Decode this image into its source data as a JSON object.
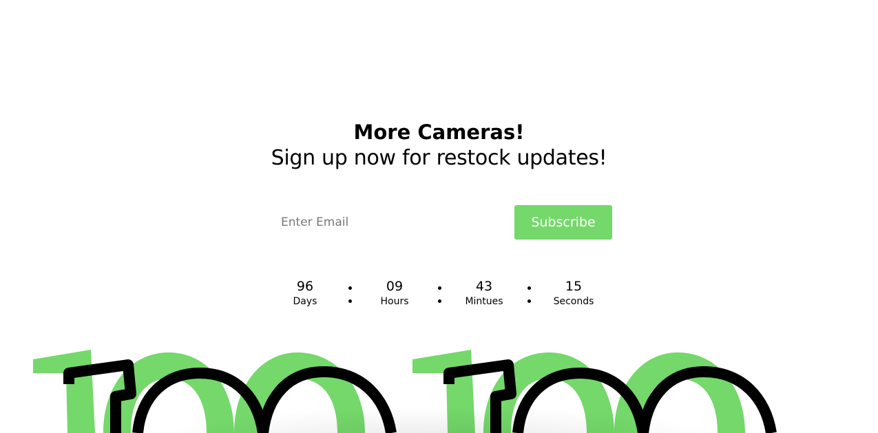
{
  "hero": {
    "title": "More Cameras!",
    "subtitle": "Sign up now for restock updates!"
  },
  "signup": {
    "email_placeholder": "Enter Email",
    "email_value": "",
    "subscribe_label": "Subscribe"
  },
  "countdown": {
    "days": {
      "value": "96",
      "label": "Days"
    },
    "hours": {
      "value": "09",
      "label": "Hours"
    },
    "minutes": {
      "value": "43",
      "label": "Mintues"
    },
    "seconds": {
      "value": "15",
      "label": "Seconds"
    }
  },
  "colors": {
    "accent": "#74d86a",
    "outline": "#000000",
    "background": "#ffffff"
  },
  "decor": {
    "icon": "number-100-graphic"
  }
}
